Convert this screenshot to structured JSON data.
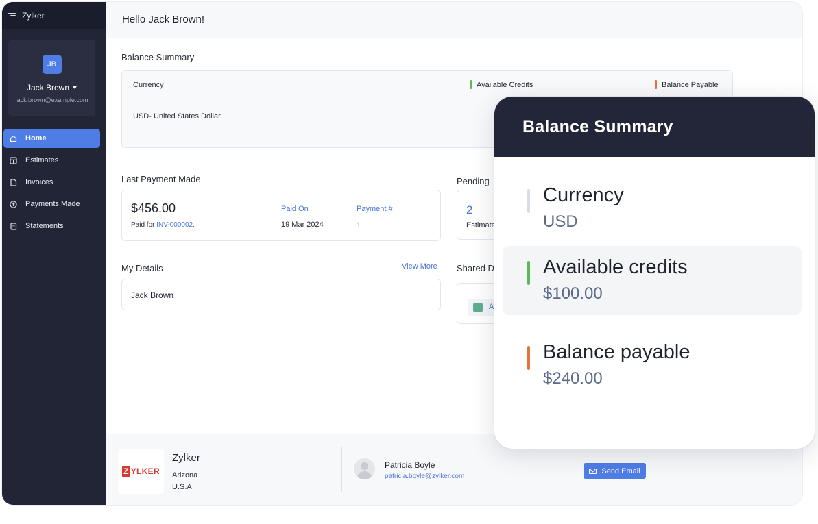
{
  "app": {
    "name": "Zylker"
  },
  "greeting": "Hello Jack Brown!",
  "profile": {
    "initials": "JB",
    "name": "Jack Brown",
    "email": "jack.brown@example.com"
  },
  "nav": [
    {
      "label": "Home",
      "icon": "home-icon",
      "active": true
    },
    {
      "label": "Estimates",
      "icon": "calculator-icon"
    },
    {
      "label": "Invoices",
      "icon": "document-icon"
    },
    {
      "label": "Payments Made",
      "icon": "upload-circle-icon"
    },
    {
      "label": "Statements",
      "icon": "statement-icon"
    }
  ],
  "balance_summary": {
    "title": "Balance Summary",
    "col_currency": "Currency",
    "col_available": "Available Credits",
    "col_payable": "Balance Payable",
    "row_currency": "USD- United States Dollar",
    "available_color": "#5cb85c",
    "payable_color": "#e8733a"
  },
  "last_payment": {
    "title": "Last Payment Made",
    "amount": "$456.00",
    "paid_for_label": "Paid for",
    "invoice": "INV-000002,",
    "paid_on_label": "Paid On",
    "paid_on": "19 Mar 2024",
    "payment_no_label": "Payment #",
    "payment_no": "1"
  },
  "pending": {
    "title": "Pending",
    "count": "2",
    "label": "Estimate"
  },
  "my_details": {
    "title": "My Details",
    "view_more": "View More",
    "name": "Jack Brown"
  },
  "shared": {
    "title": "Shared D",
    "item_letter": "A"
  },
  "footer": {
    "org_name": "Zylker",
    "org_line1": "Arizona",
    "org_line2": "U.S.A",
    "logo_text": "ZYLKER",
    "contact_name": "Patricia Boyle",
    "contact_email": "patricia.boyle@zylker.com",
    "send_email": "Send Email"
  },
  "overlay": {
    "title": "Balance Summary",
    "items": [
      {
        "label": "Currency",
        "value": "USD",
        "color": "#d6dde6"
      },
      {
        "label": "Available credits",
        "value": "$100.00",
        "color": "#5cb85c"
      },
      {
        "label": "Balance payable",
        "value": "$240.00",
        "color": "#e8733a"
      }
    ]
  }
}
